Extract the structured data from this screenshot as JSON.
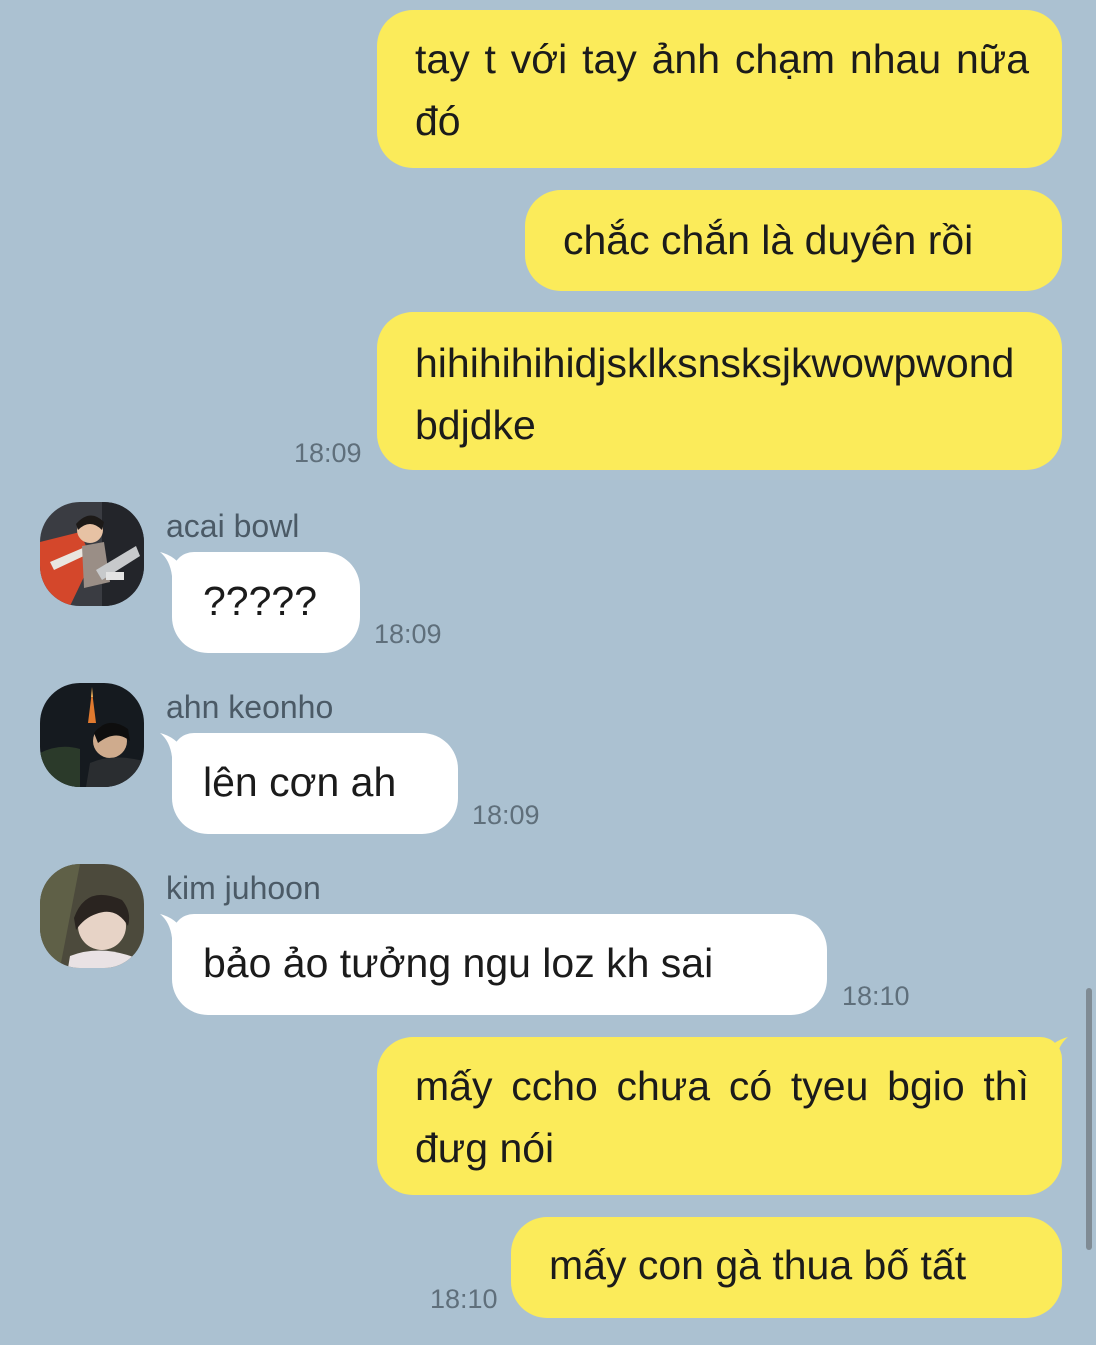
{
  "messages": [
    {
      "sender": "me",
      "text": "tay t với tay ảnh chạm nhau nữa đó"
    },
    {
      "sender": "me",
      "text": "chắc chắn là duyên rồi"
    },
    {
      "sender": "me",
      "text": "hihihihihidjsklksnsksjkwowpwondbdjdke",
      "time": "18:09"
    },
    {
      "sender": "acai bowl",
      "text": "?????",
      "time": "18:09",
      "avatar": "avatar-acai-bowl"
    },
    {
      "sender": "ahn keonho",
      "text": "lên cơn ah",
      "time": "18:09",
      "avatar": "avatar-ahn-keonho"
    },
    {
      "sender": "kim juhoon",
      "text": "bảo ảo tưởng ngu loz kh sai",
      "time": "18:10",
      "avatar": "avatar-kim-juhoon"
    },
    {
      "sender": "me",
      "text": "mấy ccho chưa có tyeu bgio thì đưg nói"
    },
    {
      "sender": "me",
      "text": "mấy con gà thua bố tất",
      "time": "18:10"
    }
  ],
  "colors": {
    "background": "#abc1d1",
    "outgoing_bubble": "#fbeb5a",
    "incoming_bubble": "#ffffff",
    "timestamp": "#5f6f7b",
    "sender_name": "#4b5a66"
  }
}
